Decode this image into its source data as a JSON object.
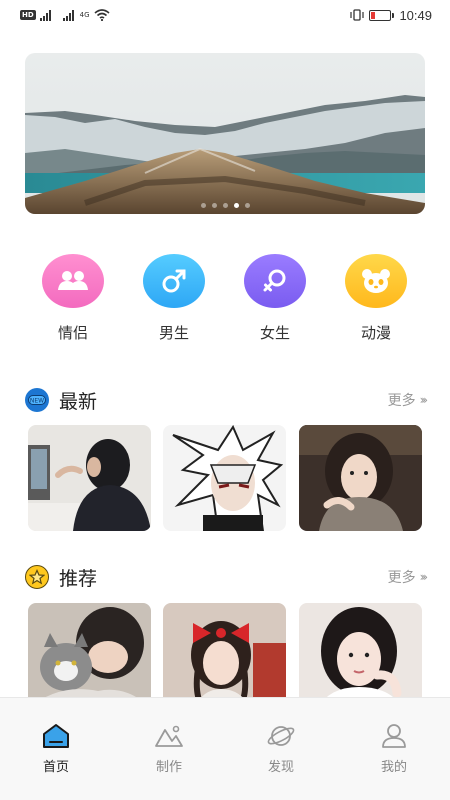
{
  "status_bar": {
    "hd": "HD",
    "network": "4G",
    "time": "10:49",
    "battery_level_percent": 20
  },
  "banner": {
    "slide_count": 5,
    "active_slide": 4
  },
  "categories": [
    {
      "label": "情侣",
      "icon": "couple-icon",
      "color_from": "#ff8fd0",
      "color_to": "#f36bbf"
    },
    {
      "label": "男生",
      "icon": "male-icon",
      "color_from": "#55ccff",
      "color_to": "#2ea7f5"
    },
    {
      "label": "女生",
      "icon": "female-icon",
      "color_from": "#9a7cff",
      "color_to": "#7a5cf0"
    },
    {
      "label": "动漫",
      "icon": "panda-icon",
      "color_from": "#ffd84a",
      "color_to": "#ffb81c"
    }
  ],
  "sections": {
    "latest": {
      "title": "最新",
      "more": "更多",
      "icon": "new-badge-icon"
    },
    "recommend": {
      "title": "推荐",
      "more": "更多",
      "icon": "star-icon"
    }
  },
  "nav": [
    {
      "label": "首页",
      "icon": "home-icon",
      "active": true
    },
    {
      "label": "制作",
      "icon": "create-icon",
      "active": false
    },
    {
      "label": "发现",
      "icon": "planet-icon",
      "active": false
    },
    {
      "label": "我的",
      "icon": "profile-icon",
      "active": false
    }
  ]
}
